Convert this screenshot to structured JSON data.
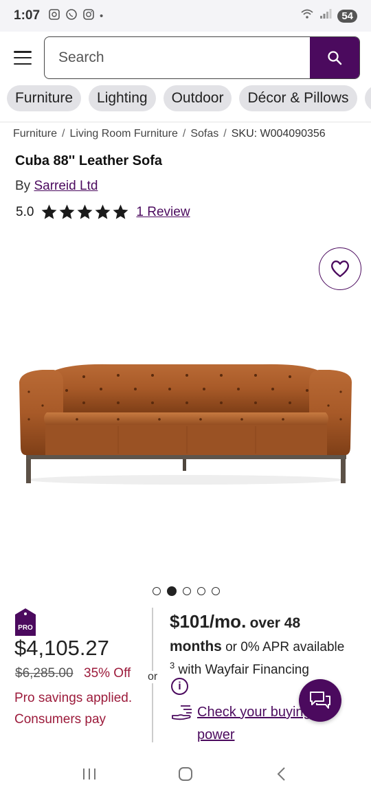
{
  "status_bar": {
    "time": "1:07",
    "battery": "54",
    "notification_dot": "•"
  },
  "search": {
    "placeholder": "Search"
  },
  "categories": [
    "Furniture",
    "Lighting",
    "Outdoor",
    "Décor & Pillows"
  ],
  "breadcrumb": {
    "items": [
      "Furniture",
      "Living Room Furniture",
      "Sofas"
    ],
    "separator": "/",
    "sku": "SKU: W004090356"
  },
  "product": {
    "title": "Cuba 88'' Leather Sofa",
    "by_label": "By",
    "brand": "Sarreid Ltd",
    "rating": "5.0",
    "stars": 5,
    "reviews_link": "1 Review"
  },
  "carousel": {
    "count": 5,
    "active_index": 1
  },
  "pricing": {
    "pro_badge": "PRO",
    "price": "$4,105.27",
    "original_price": "$6,285.00",
    "discount": "35% Off",
    "pro_note": "Pro savings applied. Consumers pay",
    "or_label": "or"
  },
  "financing": {
    "monthly": "$101/mo.",
    "over": "over 48",
    "months": "months",
    "apr_text": "or 0% APR available",
    "footnote": "3",
    "with_text": "with Wayfair Financing",
    "info_icon": "i",
    "buying_power_link": "Check your buying power"
  },
  "colors": {
    "brand_purple": "#4b0a5e",
    "sale_red": "#9c1b3b",
    "pill_bg": "#e2e2e6"
  }
}
